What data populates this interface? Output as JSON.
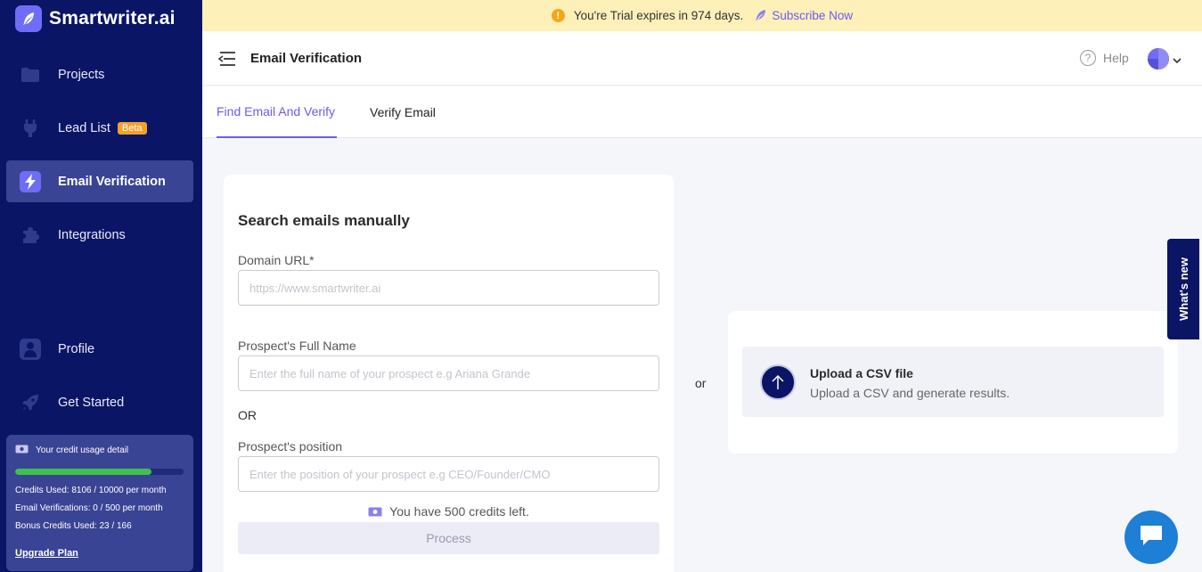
{
  "brand": {
    "name": "Smartwriter.ai"
  },
  "sidebar": {
    "items": [
      {
        "label": "Projects"
      },
      {
        "label": "Lead List",
        "badge": "Beta"
      },
      {
        "label": "Email Verification",
        "active": true
      },
      {
        "label": "Integrations"
      },
      {
        "label": "Profile"
      },
      {
        "label": "Get Started"
      }
    ],
    "credits": {
      "title": "Your credit usage detail",
      "progress": 0.81,
      "credits_used": "Credits Used: 8106 / 10000 per month",
      "email_verifications": "Email Verifications: 0 / 500 per month",
      "bonus_credits": "Bonus Credits Used: 23 / 166",
      "upgrade_label": "Upgrade Plan"
    }
  },
  "banner": {
    "text": "You're Trial expires in 974 days.",
    "link": "Subscribe Now"
  },
  "header": {
    "title": "Email Verification",
    "help_label": "Help"
  },
  "tabs": [
    {
      "label": "Find Email And Verify",
      "active": true
    },
    {
      "label": "Verify Email"
    }
  ],
  "form": {
    "title": "Search emails manually",
    "domain_label": "Domain URL*",
    "domain_placeholder": "https://www.smartwriter.ai",
    "name_label": "Prospect's Full Name",
    "name_placeholder": "Enter the full name of your prospect e.g Ariana Grande",
    "or_label": "OR",
    "position_label": "Prospect's position",
    "position_placeholder": "Enter the position of your prospect e.g CEO/Founder/CMO",
    "credits_left": "You have 500 credits left.",
    "process_label": "Process"
  },
  "separator": "or",
  "upload": {
    "title": "Upload a CSV file",
    "subtitle": "Upload a CSV and generate results."
  },
  "whats_new": "What's new",
  "colors": {
    "sidebar": "#0b1566",
    "accent": "#6a5cf0",
    "banner": "#fdf0b9",
    "progress": "#3ec24b",
    "beta": "#f4a12a",
    "chat": "#1e7fd6"
  }
}
